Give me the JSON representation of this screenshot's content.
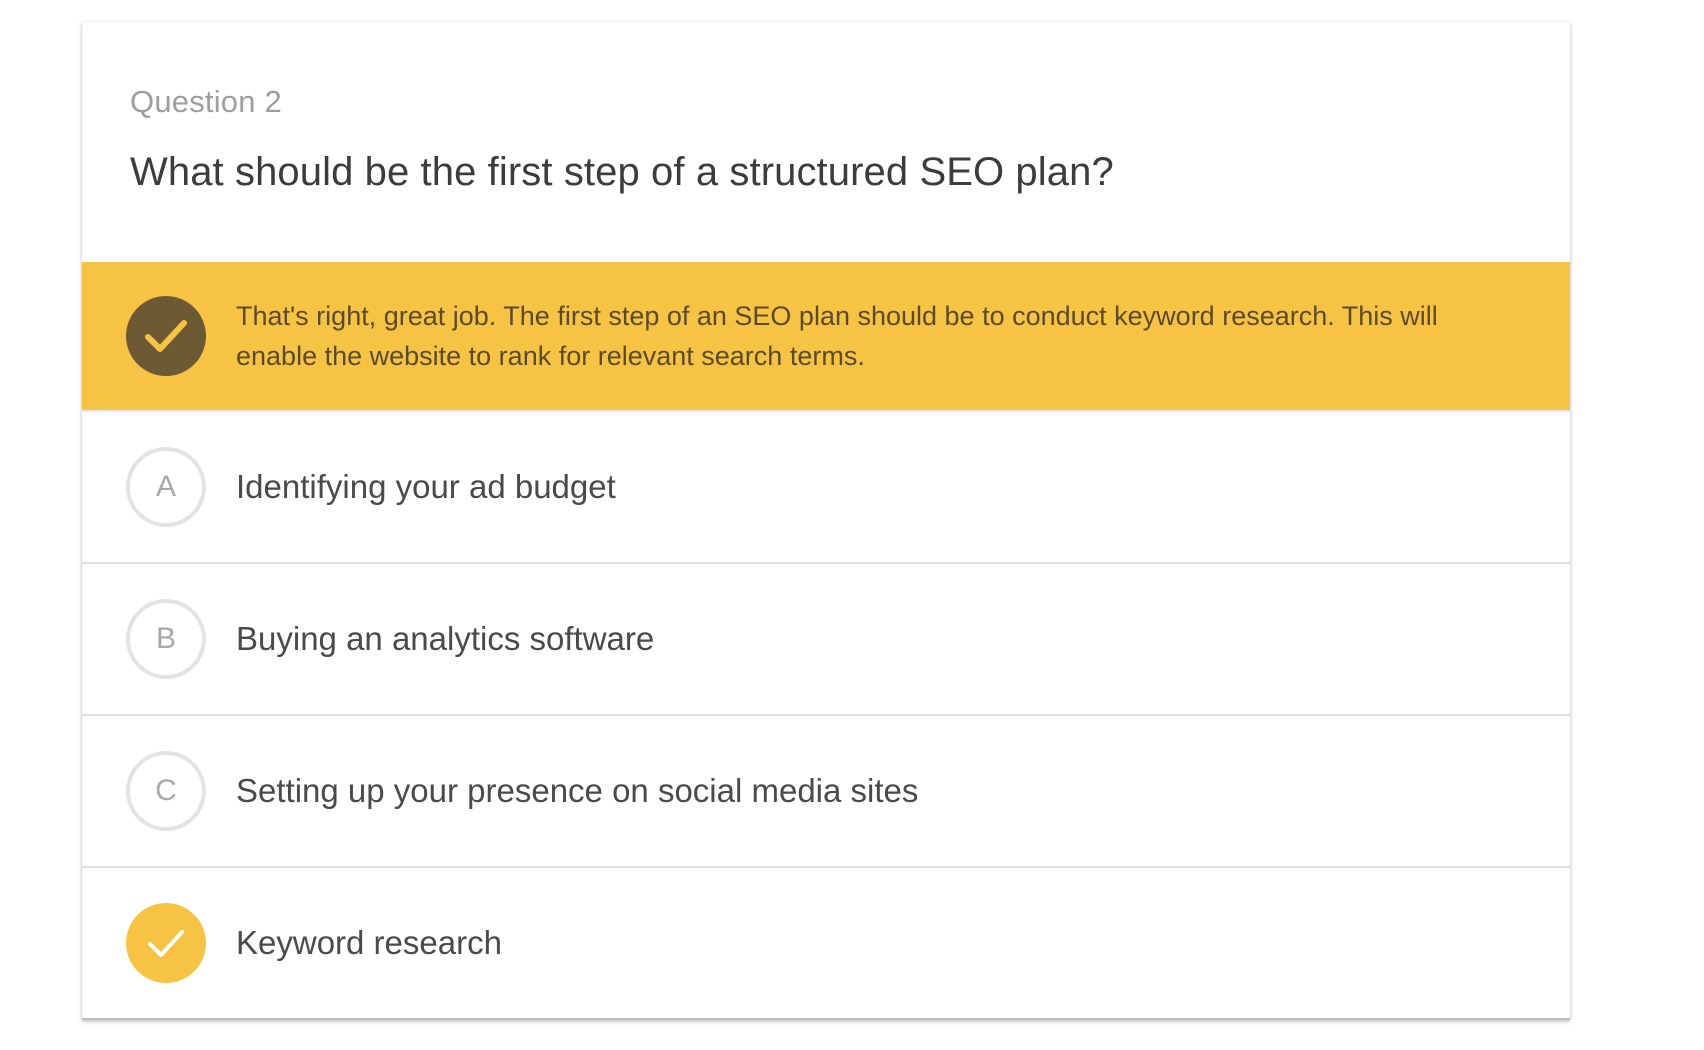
{
  "question": {
    "number_label": "Question 2",
    "text": "What should be the first step of a structured SEO plan?"
  },
  "feedback": {
    "icon": "check-icon",
    "text": "That's right, great job. The first step of an SEO plan should be to conduct keyword research. This will enable the website to rank for relevant search terms."
  },
  "options": [
    {
      "marker": "A",
      "text": "Identifying your ad budget"
    },
    {
      "marker": "B",
      "text": "Buying an analytics software"
    },
    {
      "marker": "C",
      "text": "Setting up your presence on social media sites"
    },
    {
      "marker": "",
      "icon": "check-icon",
      "selected": true,
      "text": "Keyword research"
    }
  ],
  "colors": {
    "accent": "#f6c343",
    "feedback_icon_bg": "#6b5a33",
    "feedback_text": "#5b4b2a"
  }
}
